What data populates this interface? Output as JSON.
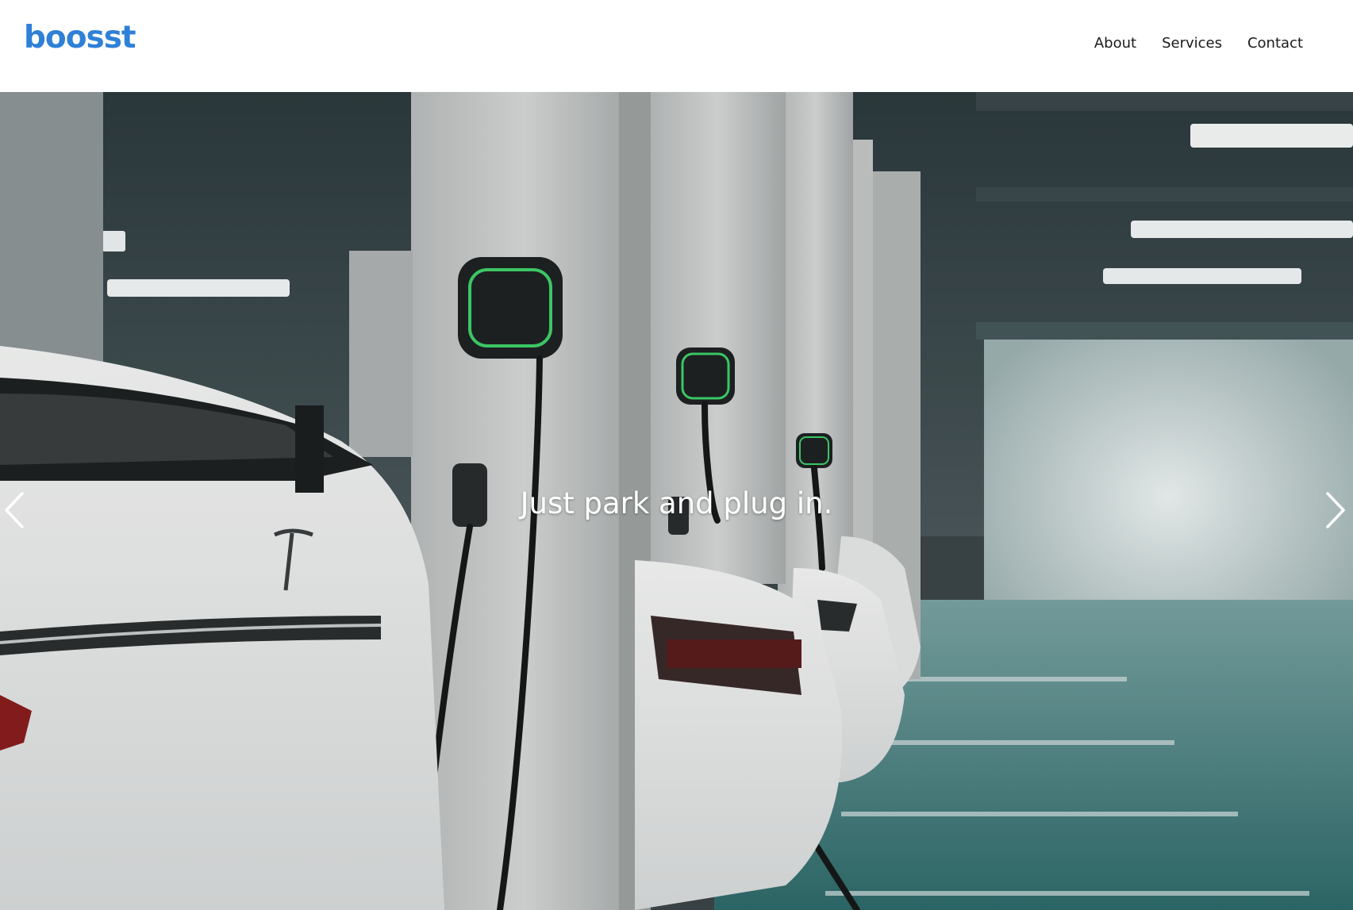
{
  "brand": {
    "logo_text": "boosst",
    "accent_color": "#2f80d7"
  },
  "nav": {
    "items": [
      {
        "label": "About"
      },
      {
        "label": "Services"
      },
      {
        "label": "Contact"
      }
    ]
  },
  "hero": {
    "caption": "Just park and plug in.",
    "image_subject": "ev-parking-garage-chargers",
    "prev_icon": "chevron-left-icon",
    "next_icon": "chevron-right-icon"
  }
}
